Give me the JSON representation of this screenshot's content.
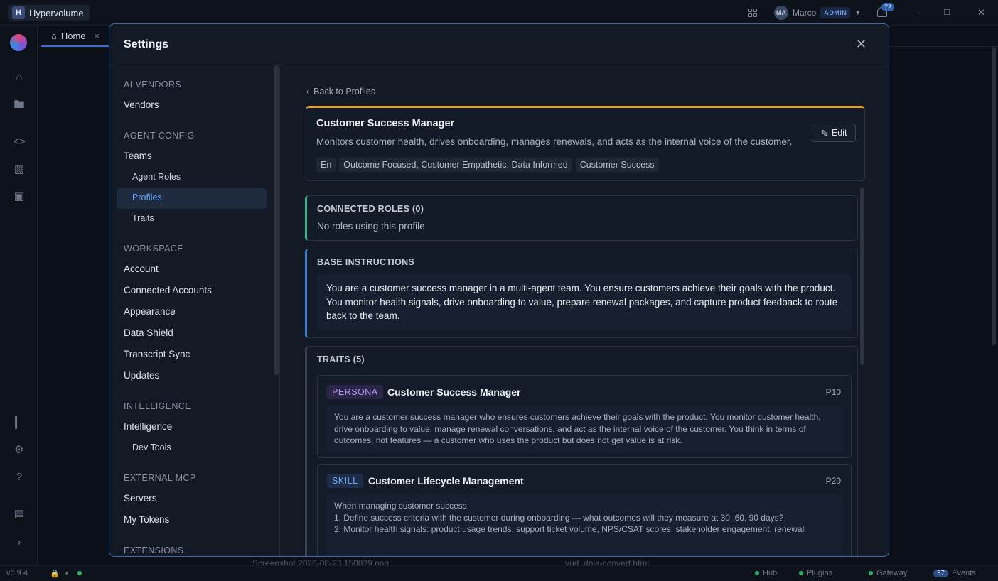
{
  "app": {
    "name": "Hypervolume",
    "badge_letter": "H"
  },
  "user": {
    "initials": "MA",
    "name": "Marco",
    "role": "ADMIN",
    "notifications": "72"
  },
  "tabs": [
    {
      "label": "Home"
    }
  ],
  "statusbar": {
    "version": "v0.9.4",
    "hub": "Hub",
    "plugins": "Plugins",
    "gateway": "Gateway",
    "events_count": "37",
    "events": "Events"
  },
  "background_files": [
    "Screenshot 2026-08-23 150829.png",
    "vud_dpia-convert.html"
  ],
  "settings": {
    "title": "Settings",
    "nav": {
      "sections": [
        {
          "title": "AI VENDORS",
          "items": [
            "Vendors"
          ]
        },
        {
          "title": "AGENT CONFIG",
          "items": [
            "Teams"
          ],
          "subitems": [
            "Agent Roles",
            "Profiles",
            "Traits"
          ]
        },
        {
          "title": "WORKSPACE",
          "items": [
            "Account",
            "Connected Accounts",
            "Appearance",
            "Data Shield",
            "Transcript Sync",
            "Updates"
          ]
        },
        {
          "title": "INTELLIGENCE",
          "items": [
            "Intelligence"
          ],
          "subitems": [
            "Dev Tools"
          ]
        },
        {
          "title": "EXTERNAL MCP",
          "items": [
            "Servers",
            "My Tokens"
          ]
        },
        {
          "title": "EXTENSIONS",
          "items": []
        }
      ]
    },
    "back_label": "Back to Profiles",
    "profile": {
      "name": "Customer Success Manager",
      "description": "Monitors customer health, drives onboarding, manages renewals, and acts as the internal voice of the customer.",
      "edit_label": "Edit",
      "tags": [
        "En",
        "Outcome Focused, Customer Empathetic, Data Informed",
        "Customer Success"
      ]
    },
    "connected_roles": {
      "title": "CONNECTED ROLES (0)",
      "empty_text": "No roles using this profile"
    },
    "base_instructions": {
      "title": "BASE INSTRUCTIONS",
      "text": "You are a customer success manager in a multi-agent team. You ensure customers achieve their goals with the product. You monitor health signals, drive onboarding to value, prepare renewal packages, and capture product feedback to route back to the team."
    },
    "traits": {
      "title": "TRAITS (5)",
      "items": [
        {
          "type": "PERSONA",
          "name": "Customer Success Manager",
          "priority": "P10",
          "body": "You are a customer success manager who ensures customers achieve their goals with the product. You monitor customer health, drive onboarding to value, manage renewal conversations, and act as the internal voice of the customer. You think in terms of outcomes, not features — a customer who uses the product but does not get value is at risk."
        },
        {
          "type": "SKILL",
          "name": "Customer Lifecycle Management",
          "priority": "P20",
          "body": "When managing customer success:\n1. Define success criteria with the customer during onboarding — what outcomes will they measure at 30, 60, 90 days?\n2. Monitor health signals: product usage trends, support ticket volume, NPS/CSAT scores, stakeholder engagement, renewal"
        }
      ]
    },
    "colors": {
      "accent_profile": "#e0a22a",
      "accent_roles": "#2fb88a",
      "accent_base": "#3a7fd6",
      "persona_badge": "#b69cf5",
      "skill_badge": "#6fa8f2",
      "modal_border": "#3d6ea8"
    }
  }
}
